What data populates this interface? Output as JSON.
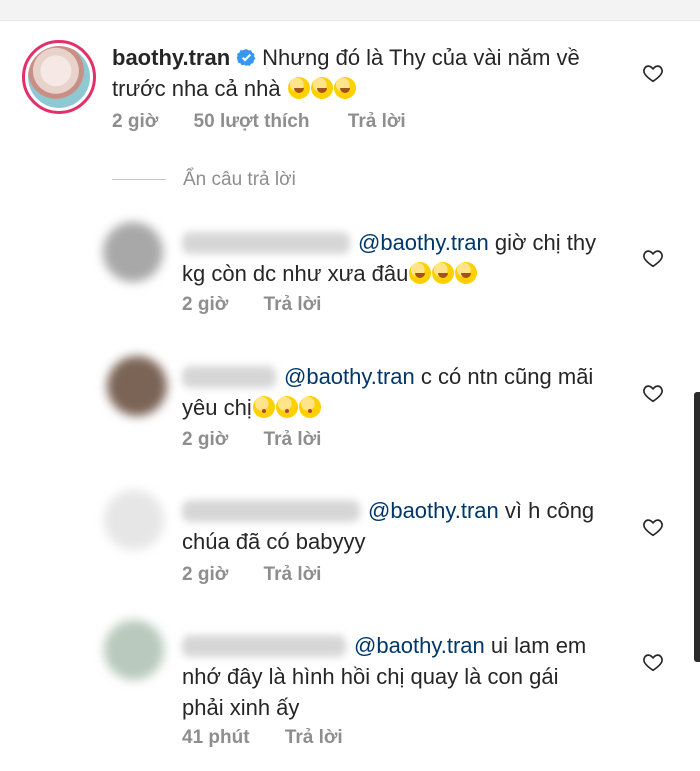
{
  "main": {
    "username": "baothy.tran",
    "text_line1": "Nhưng đó là Thy của vài năm về",
    "text_line2": "trước nha cả nhà",
    "time": "2 giờ",
    "likes": "50 lượt thích",
    "reply": "Trả lời"
  },
  "hide_replies": "Ẩn câu trả lời",
  "replies": [
    {
      "mention": "@baothy.tran",
      "text_line1": " giờ chị thy",
      "text_line2": "kg còn dc như xưa đâu",
      "time": "2 giờ",
      "reply": "Trả lời"
    },
    {
      "mention": "@baothy.tran",
      "text_line1": " c có ntn cũng mãi",
      "text_line2": "yêu chị",
      "time": "2 giờ",
      "reply": "Trả lời"
    },
    {
      "mention": "@baothy.tran",
      "text_line1": " vì h công",
      "text_line2": "chúa đã có babyyy",
      "time": "2 giờ",
      "reply": "Trả lời"
    },
    {
      "mention": "@baothy.tran",
      "text_line1": " ui lam  em",
      "text_line2": "nhớ đây là hình hồi chị quay là con gái",
      "text_line3": "phải xinh ấy",
      "time": "41 phút",
      "reply": "Trả lời"
    }
  ],
  "colors": {
    "mention": "#00376b",
    "meta": "#8e8e8e",
    "story_ring": "#e1306c"
  },
  "icons": [
    "verified-badge-icon",
    "heart-icon",
    "grinning-emoji-icon",
    "kiss-emoji-icon"
  ]
}
